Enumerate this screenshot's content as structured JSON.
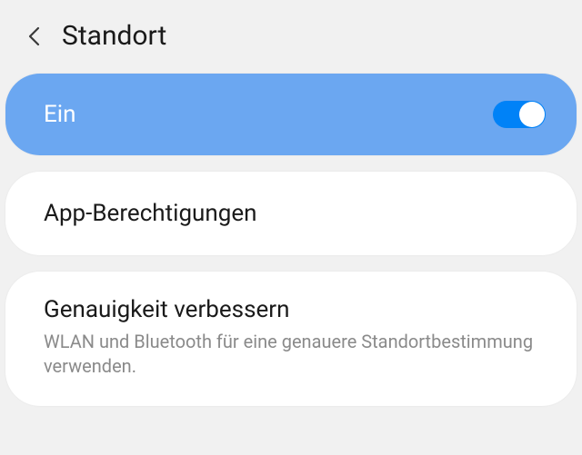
{
  "header": {
    "title": "Standort"
  },
  "toggle": {
    "label": "Ein",
    "on": true
  },
  "items": [
    {
      "title": "App-Berechtigungen"
    },
    {
      "title": "Genauigkeit verbessern",
      "subtitle": "WLAN und Bluetooth für eine genauere Standortbestimmung verwenden."
    }
  ],
  "colors": {
    "accent": "#6ba7f1",
    "switch_track": "#0082f7",
    "bg": "#f1f1f1"
  }
}
